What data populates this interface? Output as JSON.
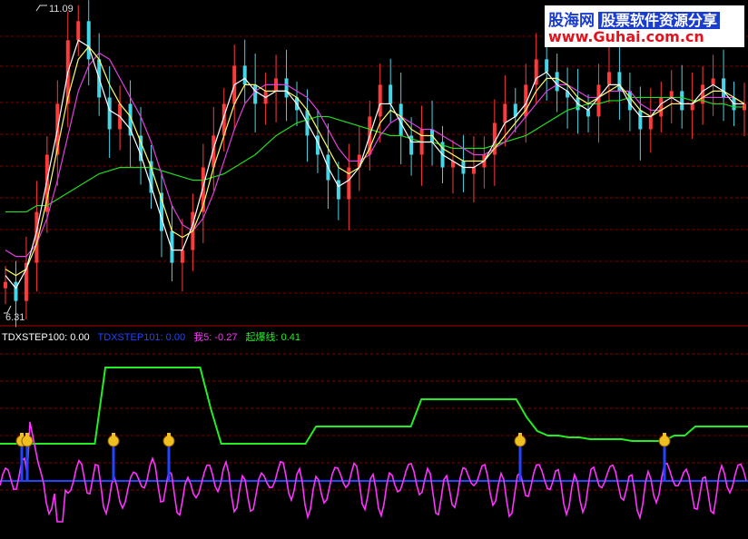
{
  "watermark": {
    "brand": "股海网",
    "tagline": "股票软件资源分享",
    "url": "www.Guhai.com.cn"
  },
  "colors": {
    "background": "#000000",
    "grid": "#7a0000",
    "divider": "#b00000",
    "candle_up": "#ff3a3a",
    "candle_down": "#44d6e6",
    "ma_fast": "#ffffff",
    "ma_mid": "#ffff66",
    "ma_slow": "#e040e0",
    "ma_long": "#22dd22",
    "step100": "#ffffff",
    "step101": "#2244ff",
    "wo5": "#ff33ff",
    "qibao": "#22ee22"
  },
  "price_panel": {
    "high_label": "11.09",
    "low_label": "6.31",
    "ylim": [
      6.31,
      11.09
    ]
  },
  "indicator_panel": {
    "legend": [
      {
        "text": "TDXSTEP100: 0.00",
        "color": "#ffffff"
      },
      {
        "text": "TDXSTEP101: 0.00",
        "color": "#2244ff"
      },
      {
        "text": "我5: -0.27",
        "color": "#ff33ff"
      },
      {
        "text": "起爆线: 0.41",
        "color": "#22ee22"
      }
    ],
    "signal_icon": "money-bag-icon",
    "signal_bars": [
      24,
      30,
      125,
      186,
      573,
      732
    ]
  },
  "chart_data": {
    "type": "line",
    "price": {
      "close": [
        6.8,
        6.5,
        7.1,
        7.9,
        8.8,
        9.6,
        10.6,
        10.9,
        10.3,
        9.7,
        9.2,
        9.6,
        9.1,
        8.7,
        8.2,
        7.6,
        7.1,
        7.3,
        7.9,
        8.6,
        9.1,
        9.6,
        10.2,
        9.9,
        9.6,
        9.8,
        10.0,
        9.7,
        9.5,
        9.1,
        8.8,
        8.4,
        8.1,
        8.6,
        8.8,
        9.4,
        9.9,
        9.6,
        9.1,
        8.8,
        9.2,
        9.0,
        8.6,
        8.7,
        8.5,
        8.6,
        8.8,
        9.3,
        9.6,
        9.4,
        9.9,
        10.3,
        10.1,
        9.8,
        9.7,
        9.5,
        9.4,
        9.9,
        10.1,
        9.8,
        9.5,
        9.2,
        9.4,
        9.7,
        9.8,
        9.5,
        9.6,
        9.9,
        10.0,
        9.7,
        9.5,
        9.6
      ],
      "ma_fast": [
        6.9,
        6.7,
        7.0,
        7.6,
        8.4,
        9.2,
        10.1,
        10.6,
        10.5,
        10.0,
        9.5,
        9.4,
        9.2,
        8.8,
        8.3,
        7.8,
        7.3,
        7.3,
        7.7,
        8.3,
        8.9,
        9.4,
        9.9,
        10.0,
        9.8,
        9.7,
        9.8,
        9.8,
        9.6,
        9.3,
        9.0,
        8.6,
        8.3,
        8.4,
        8.6,
        9.1,
        9.6,
        9.6,
        9.3,
        9.0,
        9.0,
        9.0,
        8.8,
        8.7,
        8.6,
        8.6,
        8.7,
        9.0,
        9.3,
        9.4,
        9.6,
        10.0,
        10.1,
        9.9,
        9.8,
        9.6,
        9.5,
        9.7,
        9.9,
        9.9,
        9.6,
        9.4,
        9.4,
        9.6,
        9.7,
        9.6,
        9.6,
        9.8,
        9.9,
        9.8,
        9.6,
        9.6
      ],
      "ma_mid": [
        7.0,
        6.9,
        7.0,
        7.4,
        8.1,
        8.9,
        9.7,
        10.3,
        10.5,
        10.3,
        9.9,
        9.6,
        9.4,
        9.0,
        8.6,
        8.1,
        7.6,
        7.5,
        7.6,
        8.0,
        8.6,
        9.1,
        9.6,
        9.9,
        9.9,
        9.8,
        9.8,
        9.8,
        9.7,
        9.5,
        9.2,
        8.9,
        8.6,
        8.5,
        8.6,
        8.9,
        9.3,
        9.5,
        9.4,
        9.2,
        9.1,
        9.1,
        8.9,
        8.8,
        8.7,
        8.7,
        8.7,
        8.9,
        9.1,
        9.3,
        9.5,
        9.8,
        10.0,
        10.0,
        9.9,
        9.7,
        9.6,
        9.7,
        9.8,
        9.9,
        9.7,
        9.5,
        9.4,
        9.5,
        9.6,
        9.6,
        9.6,
        9.7,
        9.8,
        9.8,
        9.7,
        9.6
      ],
      "ma_slow": [
        7.3,
        7.2,
        7.2,
        7.4,
        7.8,
        8.4,
        9.1,
        9.8,
        10.2,
        10.4,
        10.3,
        10.0,
        9.7,
        9.4,
        9.0,
        8.5,
        8.0,
        7.7,
        7.6,
        7.8,
        8.2,
        8.7,
        9.2,
        9.6,
        9.8,
        9.9,
        9.9,
        9.9,
        9.8,
        9.7,
        9.5,
        9.2,
        8.9,
        8.7,
        8.7,
        8.8,
        9.1,
        9.3,
        9.4,
        9.3,
        9.2,
        9.2,
        9.1,
        9.0,
        8.9,
        8.8,
        8.8,
        8.9,
        9.0,
        9.2,
        9.4,
        9.6,
        9.8,
        9.9,
        9.9,
        9.8,
        9.7,
        9.7,
        9.8,
        9.8,
        9.8,
        9.6,
        9.5,
        9.5,
        9.6,
        9.6,
        9.6,
        9.7,
        9.7,
        9.7,
        9.7,
        9.6
      ],
      "ma_long": [
        7.9,
        7.9,
        7.9,
        8.0,
        8.0,
        8.1,
        8.2,
        8.3,
        8.4,
        8.5,
        8.55,
        8.6,
        8.6,
        8.6,
        8.6,
        8.55,
        8.5,
        8.45,
        8.4,
        8.4,
        8.45,
        8.5,
        8.6,
        8.7,
        8.8,
        8.95,
        9.1,
        9.2,
        9.3,
        9.35,
        9.4,
        9.4,
        9.35,
        9.3,
        9.25,
        9.2,
        9.15,
        9.1,
        9.1,
        9.05,
        9.0,
        9.0,
        8.95,
        8.9,
        8.9,
        8.9,
        8.9,
        8.95,
        9.0,
        9.05,
        9.1,
        9.2,
        9.3,
        9.4,
        9.5,
        9.55,
        9.6,
        9.6,
        9.65,
        9.65,
        9.7,
        9.7,
        9.7,
        9.7,
        9.7,
        9.7,
        9.65,
        9.65,
        9.6,
        9.6,
        9.55,
        9.55
      ]
    },
    "indicator": {
      "qibao": [
        0.41,
        0.41,
        0.41,
        0.41,
        0.41,
        0.41,
        0.41,
        0.41,
        0.41,
        0.41,
        1.25,
        1.25,
        1.25,
        1.25,
        1.25,
        1.25,
        1.25,
        1.25,
        1.25,
        1.25,
        0.8,
        0.41,
        0.41,
        0.41,
        0.41,
        0.41,
        0.41,
        0.41,
        0.41,
        0.41,
        0.6,
        0.6,
        0.6,
        0.6,
        0.6,
        0.6,
        0.6,
        0.6,
        0.6,
        0.6,
        0.9,
        0.9,
        0.9,
        0.9,
        0.9,
        0.9,
        0.9,
        0.9,
        0.9,
        0.9,
        0.7,
        0.55,
        0.5,
        0.5,
        0.48,
        0.48,
        0.46,
        0.46,
        0.46,
        0.46,
        0.44,
        0.44,
        0.44,
        0.44,
        0.5,
        0.5,
        0.6,
        0.6,
        0.6,
        0.6,
        0.6,
        0.6
      ]
    }
  }
}
